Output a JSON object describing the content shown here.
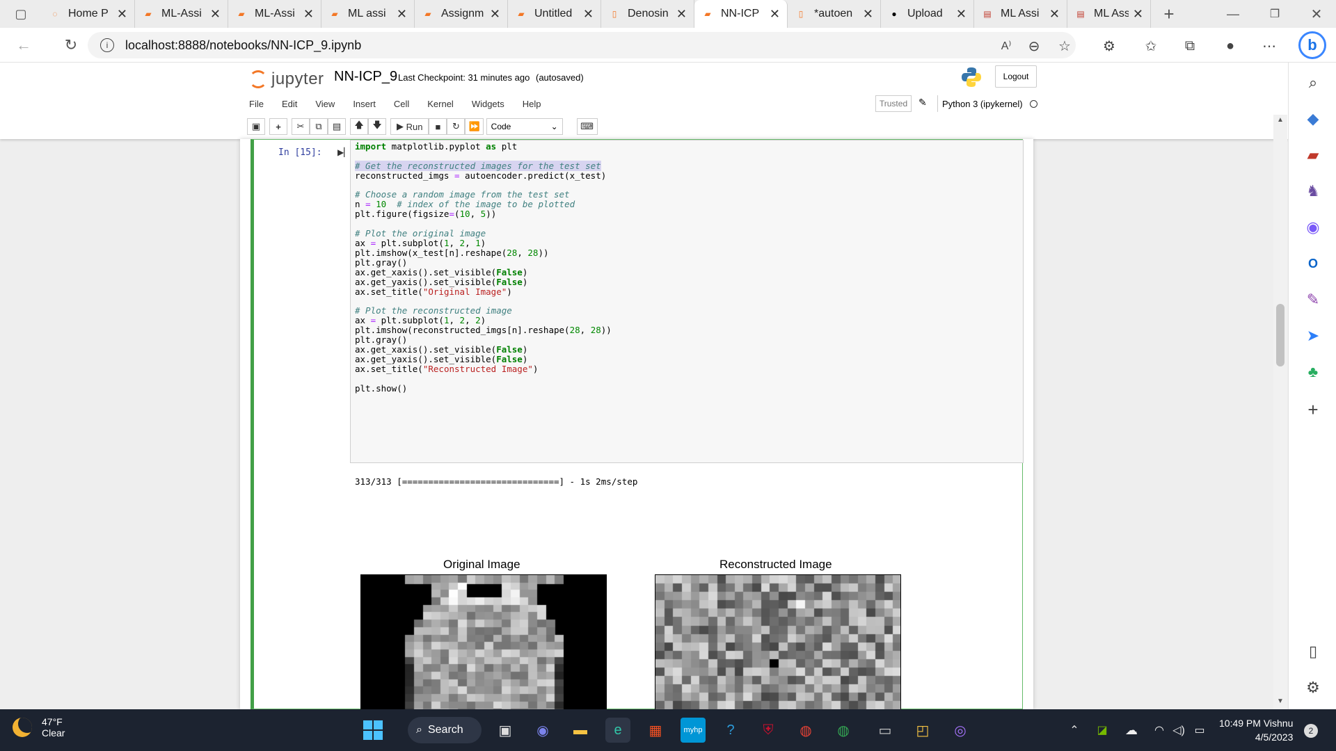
{
  "browser": {
    "tabs": [
      {
        "label": "Home P",
        "icon": "jupyter-icon",
        "color": "#f37726"
      },
      {
        "label": "ML-Assi",
        "icon": "notebook-icon",
        "color": "#f37726"
      },
      {
        "label": "ML-Assi",
        "icon": "notebook-icon",
        "color": "#f37726"
      },
      {
        "label": "ML assi",
        "icon": "notebook-icon",
        "color": "#f37726"
      },
      {
        "label": "Assignm",
        "icon": "notebook-icon",
        "color": "#f37726"
      },
      {
        "label": "Untitled",
        "icon": "notebook-icon",
        "color": "#f37726"
      },
      {
        "label": "Denosin",
        "icon": "file-icon",
        "color": "#f37726"
      },
      {
        "label": "NN-ICP",
        "icon": "notebook-icon",
        "color": "#f37726",
        "active": true
      },
      {
        "label": "*autoen",
        "icon": "file-icon",
        "color": "#f37726"
      },
      {
        "label": "Upload",
        "icon": "github-icon",
        "color": "#000000"
      },
      {
        "label": "ML Assi",
        "icon": "pdf-icon",
        "color": "#c0392b"
      },
      {
        "label": "ML Assi",
        "icon": "pdf-icon",
        "color": "#c0392b"
      }
    ],
    "url": "localhost:8888/notebooks/NN-ICP_9.ipynb"
  },
  "jupyter": {
    "logo_text": "jupyter",
    "notebook_name": "NN-ICP_9",
    "checkpoint": "Last Checkpoint: 31 minutes ago",
    "autosave": "(autosaved)",
    "logout": "Logout",
    "menu": [
      "File",
      "Edit",
      "View",
      "Insert",
      "Cell",
      "Kernel",
      "Widgets",
      "Help"
    ],
    "trusted": "Trusted",
    "kernel": "Python 3 (ipykernel)",
    "toolbar": {
      "run": "Run",
      "cell_type": "Code"
    }
  },
  "cell": {
    "prompt": "In [15]:",
    "output_text": "313/313 [==============================] - 1s 2ms/step",
    "images": [
      {
        "title": "Original Image"
      },
      {
        "title": "Reconstructed Image"
      }
    ]
  },
  "taskbar": {
    "weather_temp": "47°F",
    "weather_desc": "Clear",
    "search": "Search",
    "time": "10:49 PM Vishnu",
    "date": "4/5/2023",
    "notifications": "2"
  }
}
